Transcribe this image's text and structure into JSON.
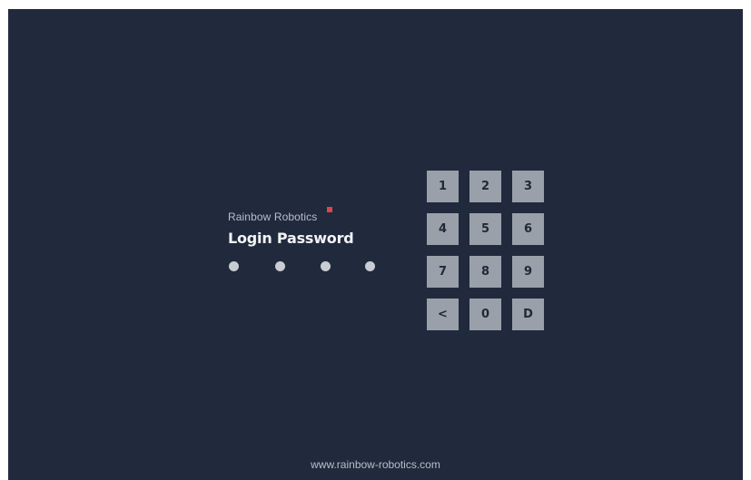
{
  "brand": {
    "name": "Rainbow Robotics",
    "accent_color": "#e0434e"
  },
  "login": {
    "title": "Login Password",
    "entered_digits": 4,
    "max_digits": 4
  },
  "keypad": {
    "keys": [
      "1",
      "2",
      "3",
      "4",
      "5",
      "6",
      "7",
      "8",
      "9",
      "<",
      "0",
      "D"
    ]
  },
  "footer": {
    "url": "www.rainbow-robotics.com"
  },
  "colors": {
    "background": "#212a3d",
    "key_background": "#9aa0a9",
    "key_text": "#1f2838",
    "dot": "#c9ccd3"
  }
}
